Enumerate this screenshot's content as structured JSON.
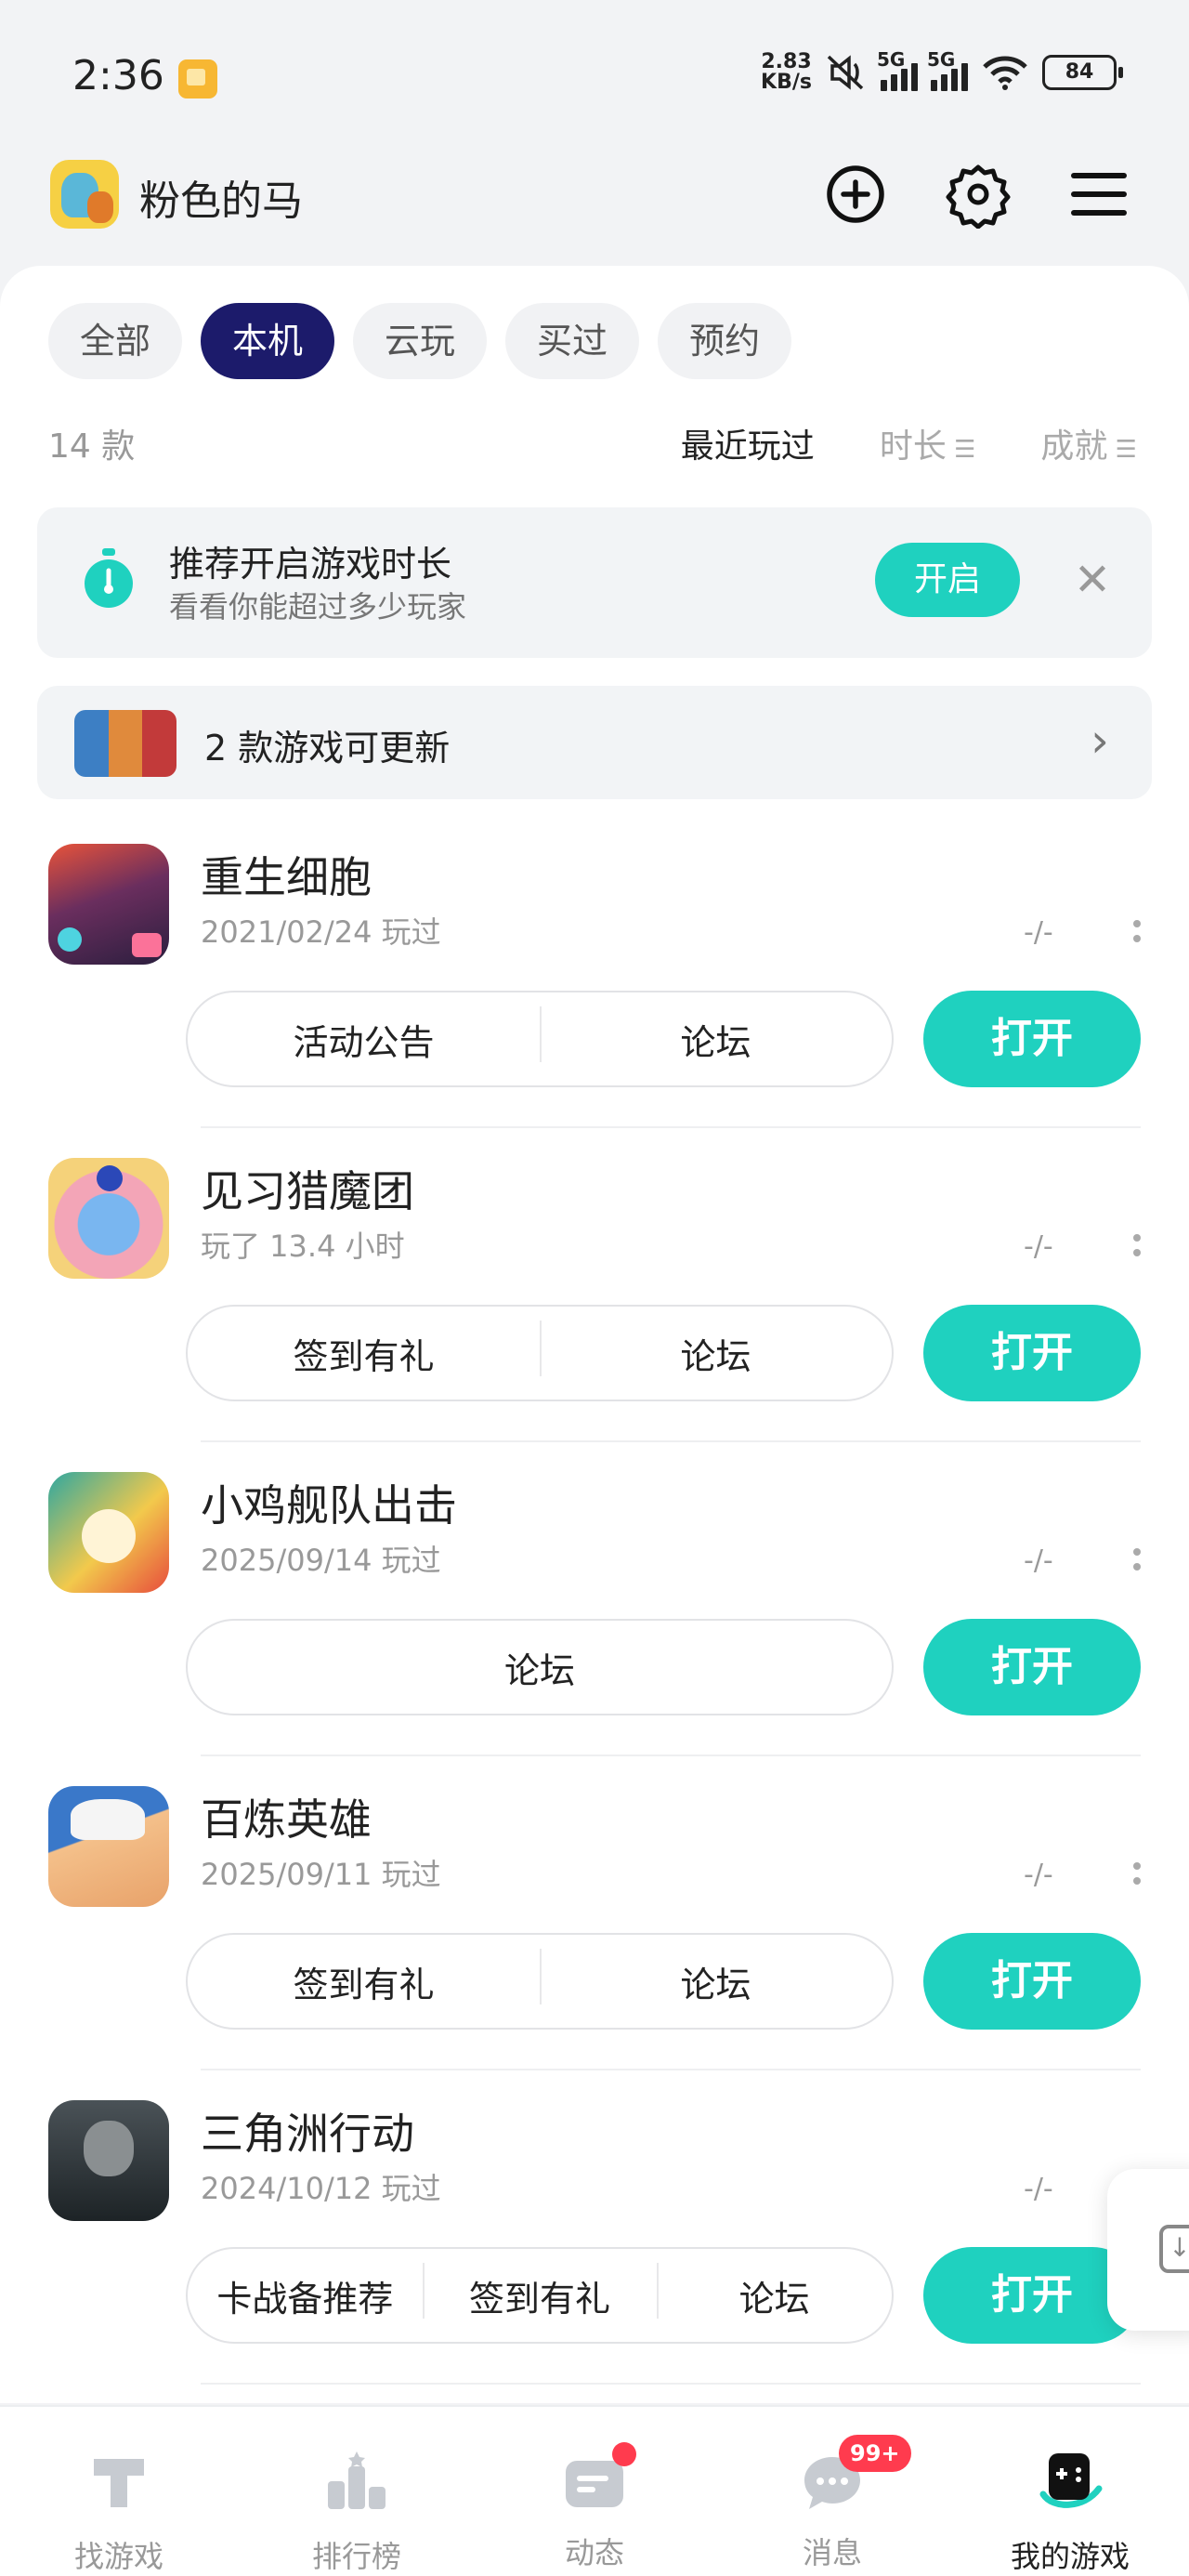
{
  "status_bar": {
    "time": "2:36",
    "net_speed_value": "2.83",
    "net_speed_unit": "KB/s",
    "signal1": "5G",
    "signal2": "5G",
    "battery": "84"
  },
  "header": {
    "username": "粉色的马",
    "icons": [
      "add-circle-icon",
      "gear-icon",
      "menu-icon"
    ]
  },
  "filters": {
    "chips": [
      "全部",
      "本机",
      "云玩",
      "买过",
      "预约"
    ],
    "active": "本机"
  },
  "list_meta": {
    "count": "14 款",
    "sort_recent": "最近玩过",
    "sort_duration": "时长",
    "sort_achievement": "成就"
  },
  "banner": {
    "title": "推荐开启游戏时长",
    "subtitle": "看看你能超过多少玩家",
    "button": "开启"
  },
  "update_bar": {
    "text": "2 款游戏可更新"
  },
  "games": [
    {
      "name": "重生细胞",
      "sub": "2021/02/24 玩过",
      "stat": "-/-",
      "actions": [
        "活动公告",
        "论坛"
      ],
      "play": "打开",
      "colors": [
        "#2b1e3e",
        "#e8533a",
        "#4ed3e0"
      ]
    },
    {
      "name": "见习猎魔团",
      "sub": "玩了 13.4 小时",
      "stat": "-/-",
      "actions": [
        "签到有礼",
        "论坛"
      ],
      "play": "打开",
      "colors": [
        "#f5d27a",
        "#79b6f0",
        "#f3a5b7"
      ]
    },
    {
      "name": "小鸡舰队出击",
      "sub": "2025/09/14 玩过",
      "stat": "-/-",
      "actions": [
        "论坛"
      ],
      "play": "打开",
      "colors": [
        "#2fa7a0",
        "#f2c94c",
        "#e74c3c"
      ]
    },
    {
      "name": "百炼英雄",
      "sub": "2025/09/11 玩过",
      "stat": "-/-",
      "actions": [
        "签到有礼",
        "论坛"
      ],
      "play": "打开",
      "colors": [
        "#3a78c9",
        "#f4c08a",
        "#f5f5f5"
      ]
    },
    {
      "name": "三角洲行动",
      "sub": "2024/10/12 玩过",
      "stat": "-/-",
      "actions": [
        "卡战备推荐",
        "签到有礼",
        "论坛"
      ],
      "play": "打开",
      "colors": [
        "#1d2326",
        "#4a5257",
        "#8a8f91"
      ]
    }
  ],
  "tabbar": [
    {
      "label": "找游戏",
      "icon": "find-game-icon"
    },
    {
      "label": "排行榜",
      "icon": "ranking-icon"
    },
    {
      "label": "动态",
      "icon": "feed-icon"
    },
    {
      "label": "消息",
      "icon": "message-icon",
      "badge": "99+"
    },
    {
      "label": "我的游戏",
      "icon": "my-games-icon",
      "active": true
    }
  ],
  "colors": {
    "accent": "#1fd1bf",
    "chip_active": "#1c1b6b",
    "badge": "#ff3b4e"
  }
}
